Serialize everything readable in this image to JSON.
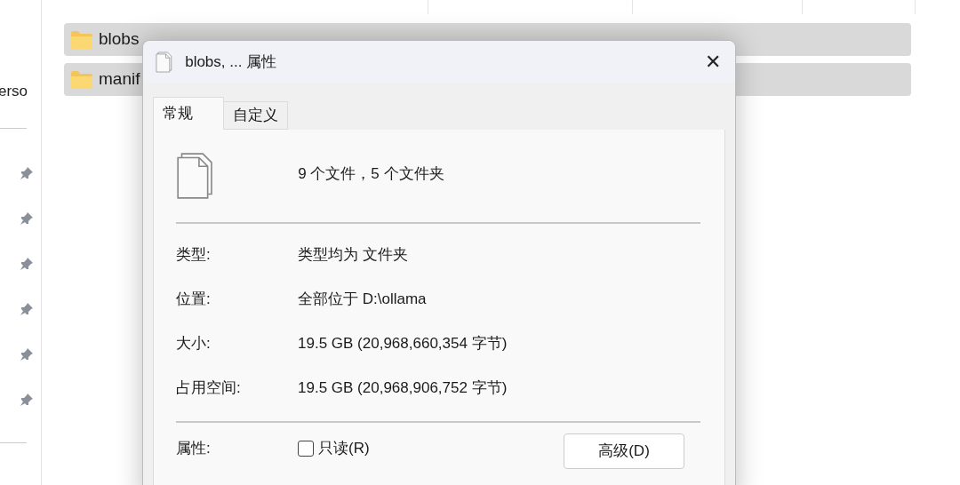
{
  "sidebar": {
    "label": "erso",
    "items": [
      {
        "pinned": true
      },
      {
        "pinned": true
      },
      {
        "pinned": true
      },
      {
        "pinned": true
      },
      {
        "pinned": true
      },
      {
        "pinned": true
      }
    ]
  },
  "file_list": {
    "rows": [
      {
        "name": "blobs",
        "selected": true
      },
      {
        "name": "manif",
        "selected": true
      }
    ]
  },
  "dialog": {
    "title": "blobs, ... 属性",
    "close": "✕",
    "tabs": [
      {
        "label": "常规",
        "selected": true
      },
      {
        "label": "自定义",
        "selected": false
      }
    ],
    "summary": "9 个文件，5 个文件夹",
    "properties": [
      {
        "label": "类型:",
        "value": "类型均为 文件夹"
      },
      {
        "label": "位置:",
        "value": "全部位于 D:\\ollama"
      },
      {
        "label": "大小:",
        "value": "19.5 GB (20,968,660,354 字节)"
      },
      {
        "label": "占用空间:",
        "value": "19.5 GB (20,968,906,752 字节)"
      }
    ],
    "attributes": {
      "label": "属性:",
      "readonly": {
        "label": "只读(R)",
        "checked": false
      },
      "advanced_button": "高级(D)"
    }
  }
}
